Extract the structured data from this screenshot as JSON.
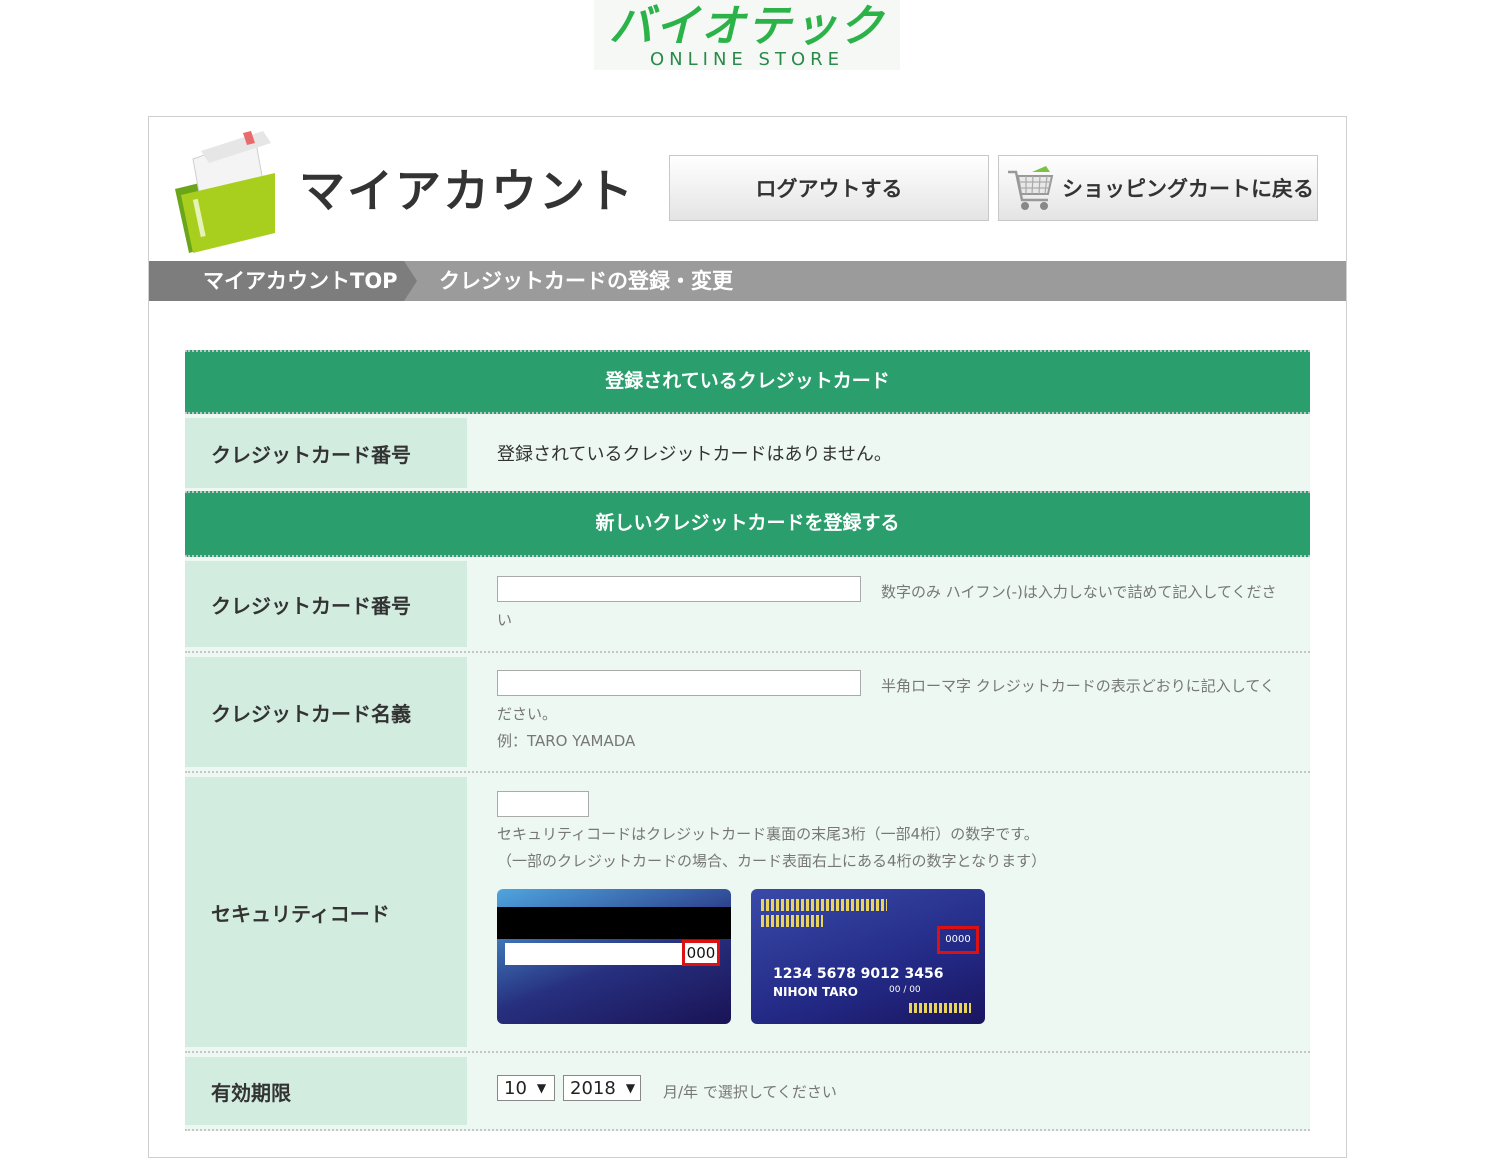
{
  "logo": {
    "main": "バイオテック",
    "sub": "ONLINE STORE"
  },
  "header": {
    "title": "マイアカウント",
    "logout_label": "ログアウトする",
    "cart_label": "ショッピングカートに戻る"
  },
  "breadcrumb": {
    "top": "マイアカウントTOP",
    "current": "クレジットカードの登録・変更"
  },
  "registered": {
    "heading": "登録されているクレジットカード",
    "label": "クレジットカード番号",
    "value": "登録されているクレジットカードはありません。"
  },
  "new_card": {
    "heading": "新しいクレジットカードを登録する",
    "number": {
      "label": "クレジットカード番号",
      "note_line1": "数字のみ ハイフン(-)は入力しないで詰めて記入してくださ",
      "note_line2": "い"
    },
    "name": {
      "label": "クレジットカード名義",
      "note_line1": "半角ローマ字 クレジットカードの表示どおりに記入してく",
      "note_line2": "ださい。",
      "example": "例：TARO YAMADA"
    },
    "security": {
      "label": "セキュリティコード",
      "note_line1": "セキュリティコードはクレジットカード裏面の末尾3桁（一部4桁）の数字です。",
      "note_line2": "（一部のクレジットカードの場合、カード表面右上にある4桁の数字となります）",
      "back_code": "000",
      "front_code": "0000",
      "front_number": "1234  5678  9012  3456",
      "front_holder": "NIHON TARO",
      "front_expiry": "00 / 00"
    },
    "expiry": {
      "label": "有効期限",
      "month": "10",
      "year": "2018",
      "note": "月/年 で選択してください"
    }
  },
  "colors": {
    "section_green": "#2a9e6c",
    "logo_green": "#2bb34a",
    "label_bg": "#d2ece0",
    "row_bg": "#edf8f2"
  }
}
